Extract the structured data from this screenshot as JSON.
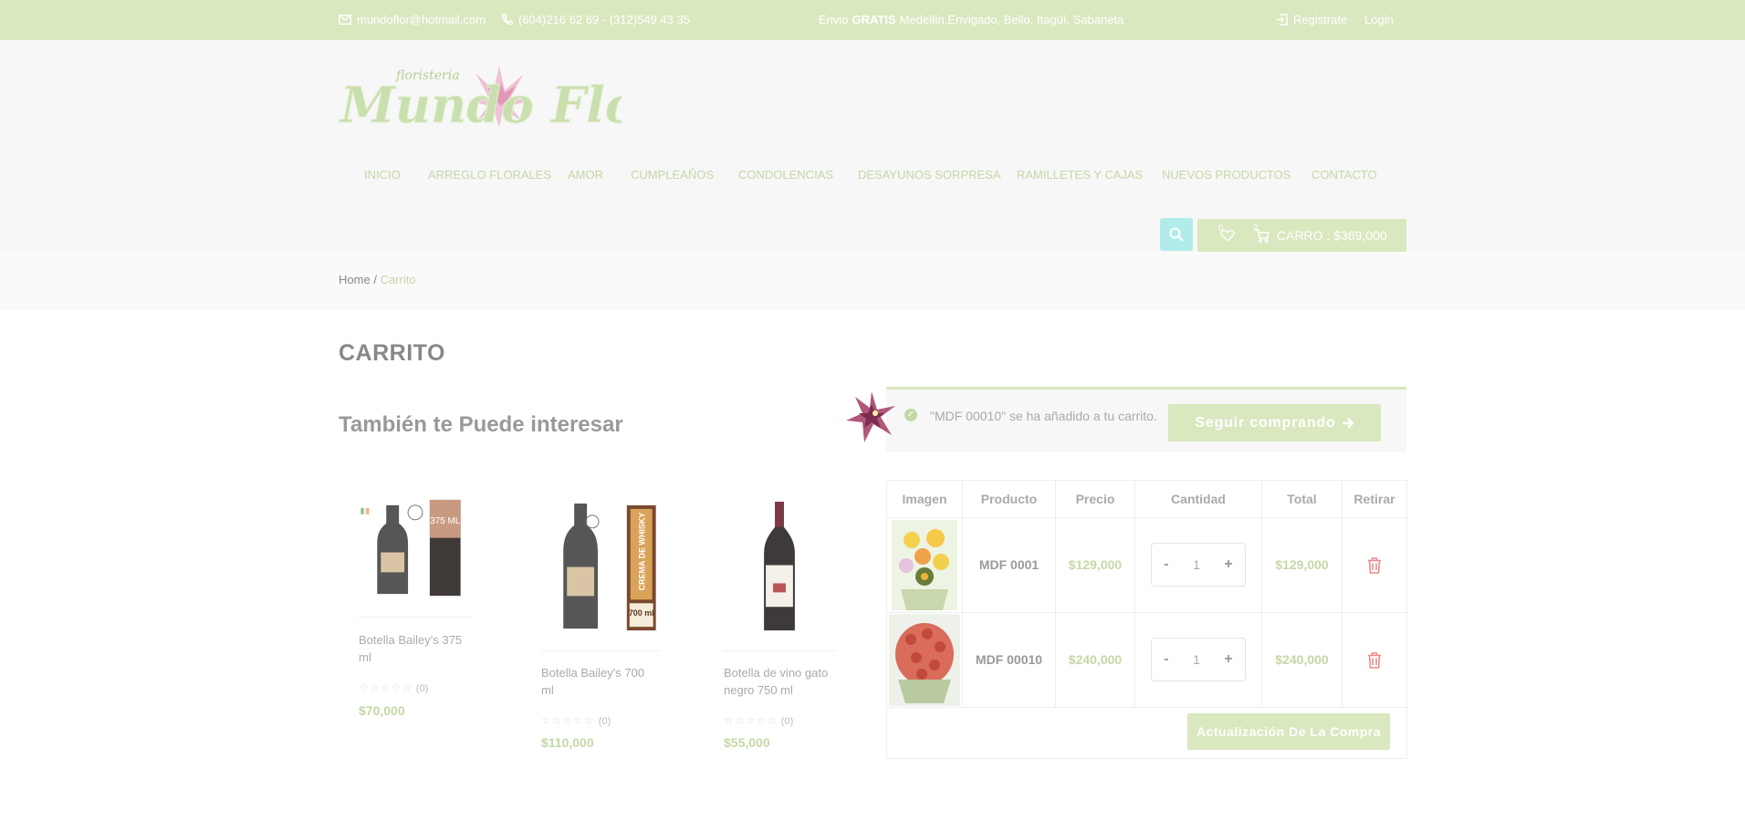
{
  "topbar": {
    "email": "mundoflor@hotmail.com",
    "phones": "(604)216 62 69 - (312)549 43 35",
    "shipping_prefix": "Envio",
    "shipping_bold": "GRATIS",
    "shipping_rest": "Medellín,Envigado, Bello, Itagüí, Sabaneta",
    "register": "Registrate",
    "login": "Login"
  },
  "logo": {
    "script_small": "floristeria",
    "script_main": "Mundo Flor"
  },
  "nav": [
    "INICIO",
    "ARREGLO FLORALES",
    "AMOR",
    "CUMPLEAÑOS",
    "CONDOLENCIAS",
    "DESAYUNOS SORPRESA",
    "RAMILLETES Y CAJAS",
    "NUEVOS PRODUCTOS",
    "CONTACTO"
  ],
  "cart_button": {
    "wishlist_count": "0",
    "cart_count": "2",
    "label": "CARRO : $369,000"
  },
  "breadcrumb": {
    "home": "Home",
    "separator": "/",
    "current": "Carrito"
  },
  "page_title": "CARRITO",
  "related_title": "También te Puede interesar",
  "related_products": [
    {
      "name": "Botella Bailey's 375 ml",
      "rating": "(0)",
      "price": "$70,000",
      "badge": "375 ML"
    },
    {
      "name": "Botella Bailey's 700 ml",
      "rating": "(0)",
      "price": "$110,000",
      "badge": "700 ml",
      "band": "CREMA DE WHISKY"
    },
    {
      "name": "Botella de vino gato negro 750 ml",
      "rating": "(0)",
      "price": "$55,000"
    }
  ],
  "notice": {
    "message": "\"MDF 00010\" se ha añadido a tu carrito.",
    "button": "Seguir comprando"
  },
  "cart_table": {
    "headers": [
      "Imagen",
      "Producto",
      "Precio",
      "Cantidad",
      "Total",
      "Retirar"
    ],
    "rows": [
      {
        "product": "MDF 0001",
        "price": "$129,000",
        "qty": "1",
        "total": "$129,000"
      },
      {
        "product": "MDF 00010",
        "price": "$240,000",
        "qty": "1",
        "total": "$240,000"
      }
    ],
    "minus": "-",
    "plus": "+",
    "update_button": "Actualización De La Compra"
  },
  "colors": {
    "accent_green": "#d9e8bf",
    "text_green": "#c3d8a6",
    "search_cyan": "#b2ecea",
    "delete_red": "#e88a8a"
  }
}
